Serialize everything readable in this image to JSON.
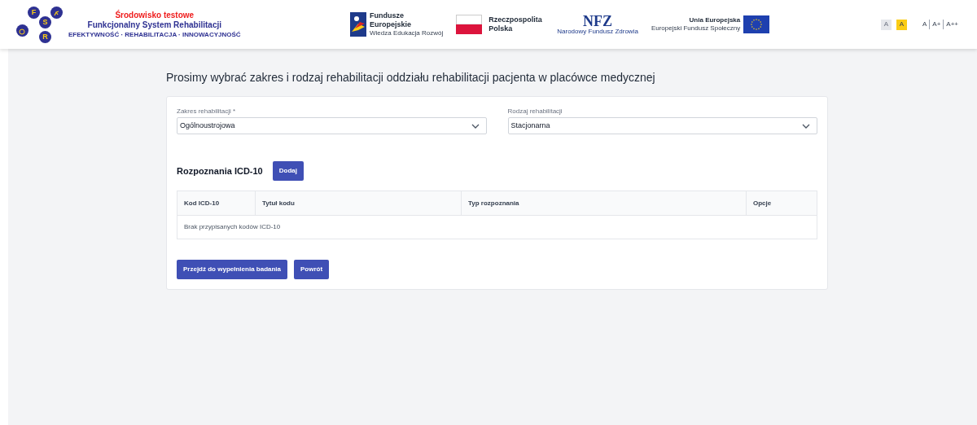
{
  "header": {
    "logo": {
      "letters": [
        "F",
        "S",
        "R"
      ],
      "env": "Środowisko testowe",
      "name": "Funkcjonalny System Rehabilitacji",
      "tagline": "EFEKTYWNOŚĆ · REHABILITACJA · INNOWACYJNOŚĆ"
    },
    "partners": [
      {
        "kind": "fe",
        "title": "Fundusze Europejskie",
        "subtitle": "Wiedza Edukacja Rozwój"
      },
      {
        "kind": "pl",
        "title": "Rzeczpospolita Polska"
      },
      {
        "kind": "nfz",
        "title": "NFZ",
        "subtitle": "Narodowy Fundusz Zdrowia"
      },
      {
        "kind": "ue",
        "title": "Unia Europejska",
        "subtitle": "Europejski Fundusz Społeczny"
      }
    ],
    "contrast": [
      {
        "label": "A",
        "selected": false
      },
      {
        "label": "A",
        "selected": true
      }
    ],
    "font_sizes": [
      "A",
      "A+",
      "A++"
    ]
  },
  "page_title": "Prosimy wybrać zakres i rodzaj rehabilitacji oddziału rehabilitacji pacjenta w placówce medycznej",
  "selects": [
    {
      "label": "Zakres rehabilitacji *",
      "value": "Ogólnoustrojowa"
    },
    {
      "label": "Rodzaj rehabilitacji",
      "value": "Stacjonarna"
    }
  ],
  "section": {
    "title": "Rozpoznania ICD-10",
    "button": "Dodaj"
  },
  "table": {
    "columns": [
      "Kod ICD-10",
      "Tytuł kodu",
      "Typ rozpoznania",
      "Opcje"
    ],
    "empty": "Brak przypisanych kodów ICD-10"
  },
  "buttons": [
    "Przejdź do wypełnienia badania",
    "Powrót"
  ]
}
